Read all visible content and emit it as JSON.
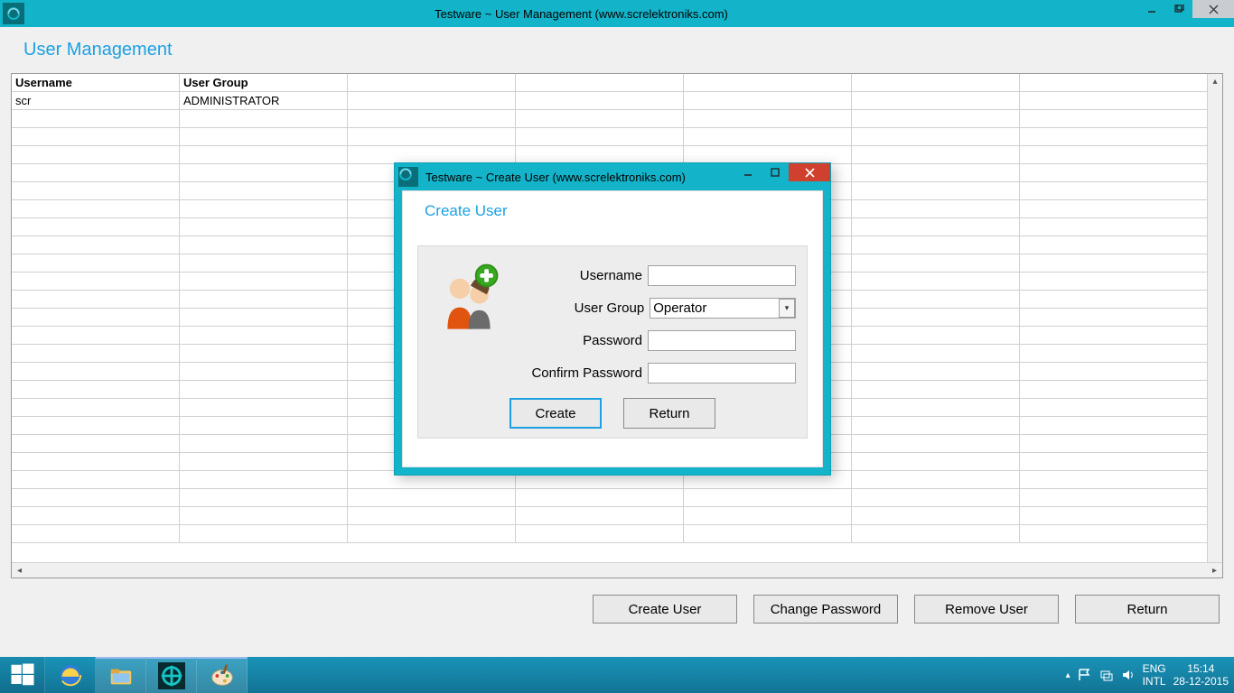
{
  "outer_window": {
    "title": "Testware ~ User Management (www.screlektroniks.com)"
  },
  "page": {
    "heading": "User Management",
    "columns": [
      "Username",
      "User Group"
    ],
    "rows": [
      {
        "username": "scr",
        "group": "ADMINISTRATOR"
      }
    ],
    "buttons": {
      "create": "Create User",
      "change_pw": "Change Password",
      "remove": "Remove User",
      "return": "Return"
    }
  },
  "dialog": {
    "title": "Testware ~ Create User (www.screlektroniks.com)",
    "heading": "Create User",
    "labels": {
      "username": "Username",
      "group": "User Group",
      "password": "Password",
      "confirm": "Confirm Password"
    },
    "group_value": "Operator",
    "buttons": {
      "create": "Create",
      "return": "Return"
    }
  },
  "taskbar": {
    "lang1": "ENG",
    "lang2": "INTL",
    "time": "15:14",
    "date": "28-12-2015"
  }
}
